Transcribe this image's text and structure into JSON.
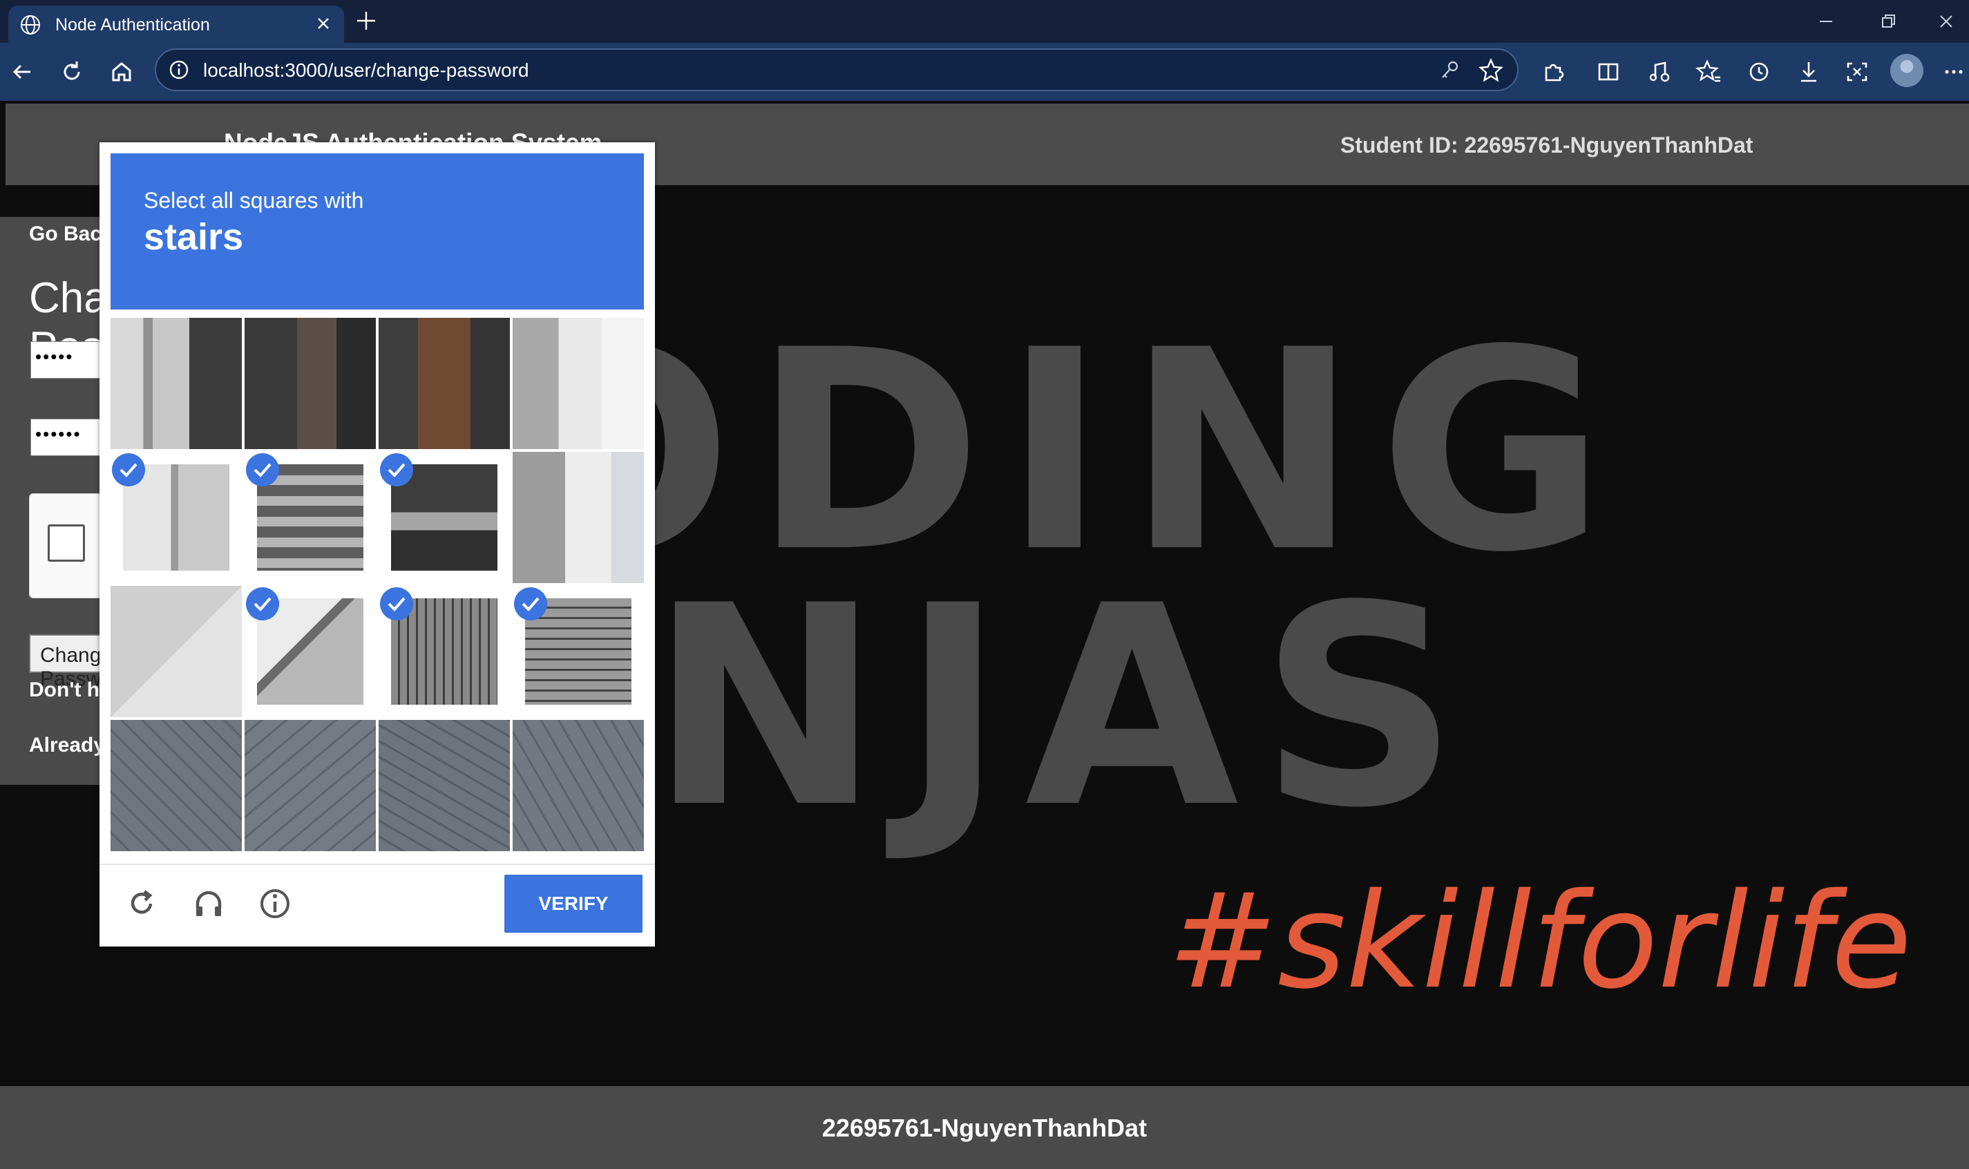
{
  "browser": {
    "tab_title": "Node Authentication",
    "url": "localhost:3000/user/change-password"
  },
  "header": {
    "brand": "NodeJS Authentication System",
    "student_id": "Student ID: 22695761-NguyenThanhDat"
  },
  "form": {
    "go_back": "Go Back",
    "title": "Change Password",
    "old_password_mask": "•••••",
    "new_password_mask": "••••••",
    "submit_label": "Change Password",
    "signup_prompt": "Don't have an account?",
    "signin_prompt": "Already have an account?"
  },
  "captcha": {
    "instruction": "Select all squares with",
    "keyword": "stairs",
    "verify_label": "VERIFY",
    "tiles_selected": [
      false,
      false,
      false,
      false,
      true,
      true,
      true,
      false,
      false,
      true,
      true,
      true,
      false,
      false,
      false,
      false
    ]
  },
  "hero": {
    "line1": "ODING",
    "line2": "NJAS",
    "hashtag": "#skillforlife"
  },
  "footer": {
    "text": "22695761-NguyenThanhDat"
  },
  "colors": {
    "captcha_blue": "#3b74de",
    "hashtag_orange": "#e35a3a",
    "panel_gray": "#4a4a4a"
  }
}
